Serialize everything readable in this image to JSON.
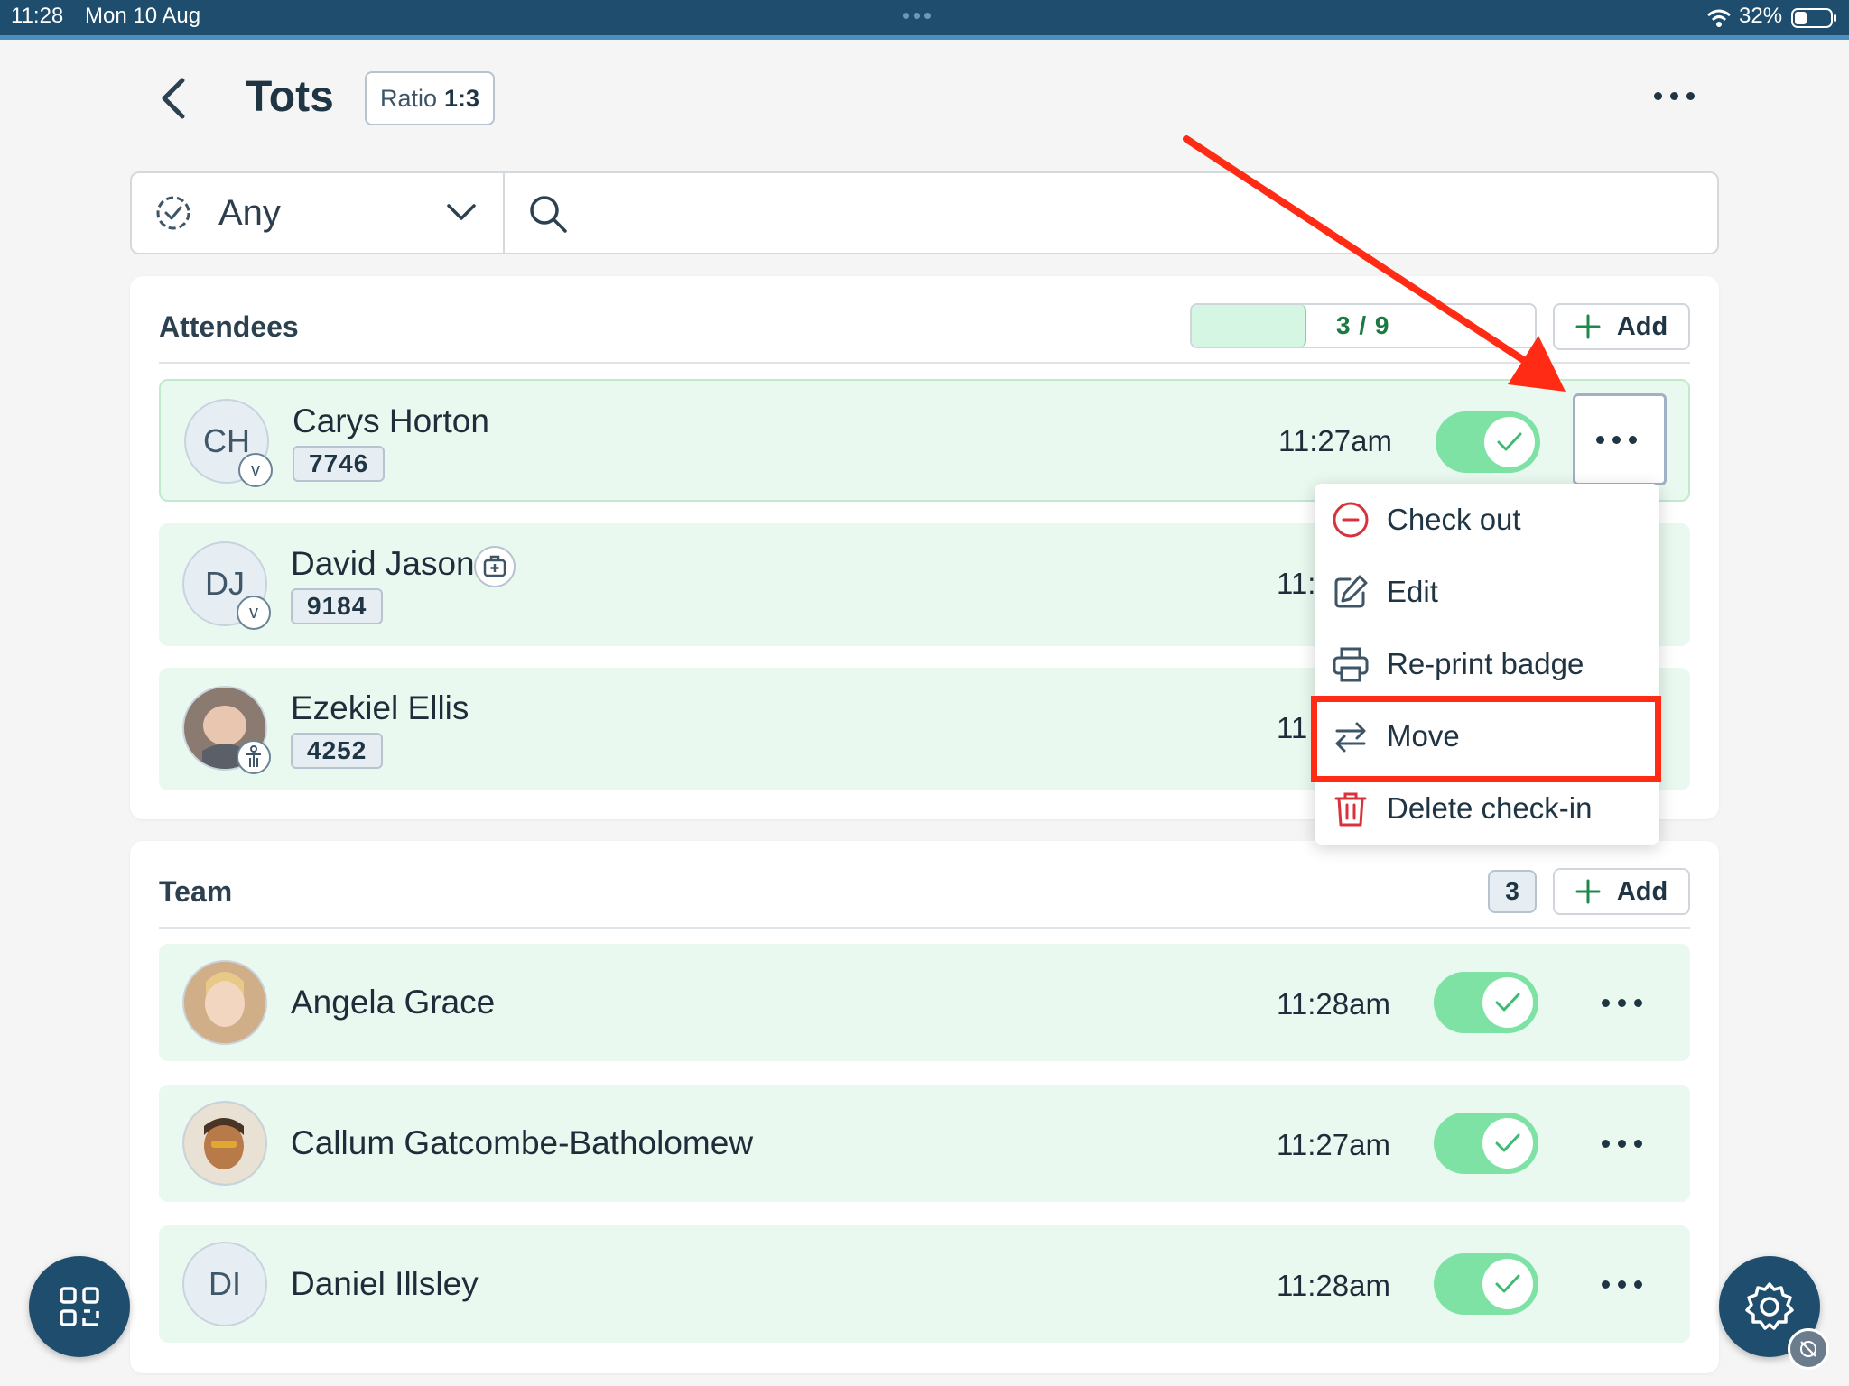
{
  "status_bar": {
    "time": "11:28",
    "date": "Mon 10 Aug",
    "battery": "32%"
  },
  "header": {
    "title": "Tots",
    "ratio_label": "Ratio",
    "ratio_value": "1:3"
  },
  "filter": {
    "selected": "Any",
    "search_placeholder": ""
  },
  "attendees": {
    "title": "Attendees",
    "progress": {
      "text": "3 / 9",
      "checked_in": 3,
      "capacity": 9
    },
    "add_label": "Add",
    "rows": [
      {
        "initials": "CH",
        "badge": "v",
        "name": "Carys Horton",
        "pin": "7746",
        "time": "11:27am",
        "checked_in": true
      },
      {
        "initials": "DJ",
        "badge": "v",
        "name": "David Jason",
        "pin": "9184",
        "time": "11:",
        "checked_in": true
      },
      {
        "initials": "",
        "badge": "",
        "name": "Ezekiel Ellis",
        "pin": "4252",
        "time": "11",
        "checked_in": true
      }
    ]
  },
  "menu": {
    "items": [
      {
        "label": "Check out",
        "icon": "minus-circle-icon"
      },
      {
        "label": "Edit",
        "icon": "edit-icon"
      },
      {
        "label": "Re-print badge",
        "icon": "printer-icon"
      },
      {
        "label": "Move",
        "icon": "swap-arrows-icon"
      },
      {
        "label": "Delete check-in",
        "icon": "trash-icon"
      }
    ]
  },
  "team": {
    "title": "Team",
    "count": "3",
    "add_label": "Add",
    "rows": [
      {
        "initials": "",
        "name": "Angela Grace",
        "time": "11:28am",
        "checked_in": true
      },
      {
        "initials": "",
        "name": "Callum Gatcombe-Batholomew",
        "time": "11:27am",
        "checked_in": true
      },
      {
        "initials": "DI",
        "name": "Daniel Illsley",
        "time": "11:28am",
        "checked_in": true
      }
    ]
  },
  "colors": {
    "accent": "#1e4d6e",
    "success": "#7ee2a4",
    "danger": "#d8323c",
    "annotation": "#ff2b14"
  }
}
